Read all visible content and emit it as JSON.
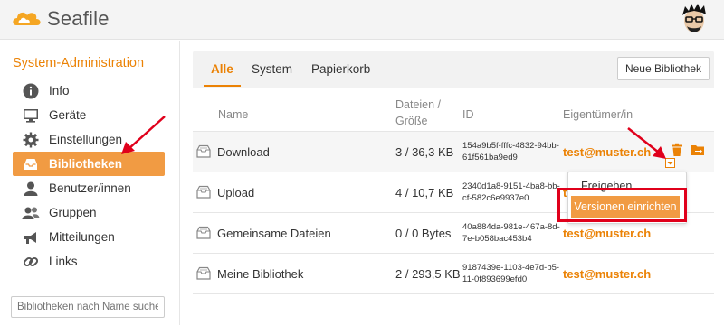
{
  "header": {
    "app_name": "Seafile",
    "logo_color": "#f5a623"
  },
  "sidebar": {
    "title": "System-Administration",
    "items": [
      {
        "label": "Info",
        "icon": "info-icon"
      },
      {
        "label": "Geräte",
        "icon": "monitor-icon"
      },
      {
        "label": "Einstellungen",
        "icon": "gear-icon"
      },
      {
        "label": "Bibliotheken",
        "icon": "inbox-icon",
        "active": true
      },
      {
        "label": "Benutzer/innen",
        "icon": "user-icon"
      },
      {
        "label": "Gruppen",
        "icon": "group-icon"
      },
      {
        "label": "Mitteilungen",
        "icon": "megaphone-icon"
      },
      {
        "label": "Links",
        "icon": "link-icon"
      }
    ],
    "search_placeholder": "Bibliotheken nach Name suchen"
  },
  "tabs": {
    "items": [
      "Alle",
      "System",
      "Papierkorb"
    ],
    "active": "Alle",
    "new_library_button": "Neue Bibliothek"
  },
  "table": {
    "columns": {
      "name": "Name",
      "files_line1": "Dateien /",
      "files_line2": "Größe",
      "id": "ID",
      "owner": "Eigentümer/in"
    },
    "rows": [
      {
        "name": "Download",
        "size": "3 / 36,3 KB",
        "id_line1": "154a9b5f-fffc-4832-94bb-",
        "id_line2": "61f561ba9ed9",
        "owner": "test@muster.ch"
      },
      {
        "name": "Upload",
        "size": "4 / 10,7 KB",
        "id_line1": "2340d1a8-9151-4ba8-bb-",
        "id_line2": "cf-582c6e9937e0",
        "owner": "t"
      },
      {
        "name": "Gemeinsame Dateien",
        "size": "0 / 0 Bytes",
        "id_line1": "40a884da-981e-467a-8d-",
        "id_line2": "7e-b058bac453b4",
        "owner": "test@muster.ch"
      },
      {
        "name": "Meine Bibliothek",
        "size": "2 / 293,5 KB",
        "id_line1": "9187439e-1103-4e7d-b5-",
        "id_line2": "11-0f893699efd0",
        "owner": "test@muster.ch"
      }
    ]
  },
  "dropdown": {
    "items": [
      "Freigeben",
      "Versionen einrichten"
    ]
  },
  "colors": {
    "accent": "#eb8205",
    "active_bg": "#f19b43",
    "annotation_red": "#e0001b"
  }
}
